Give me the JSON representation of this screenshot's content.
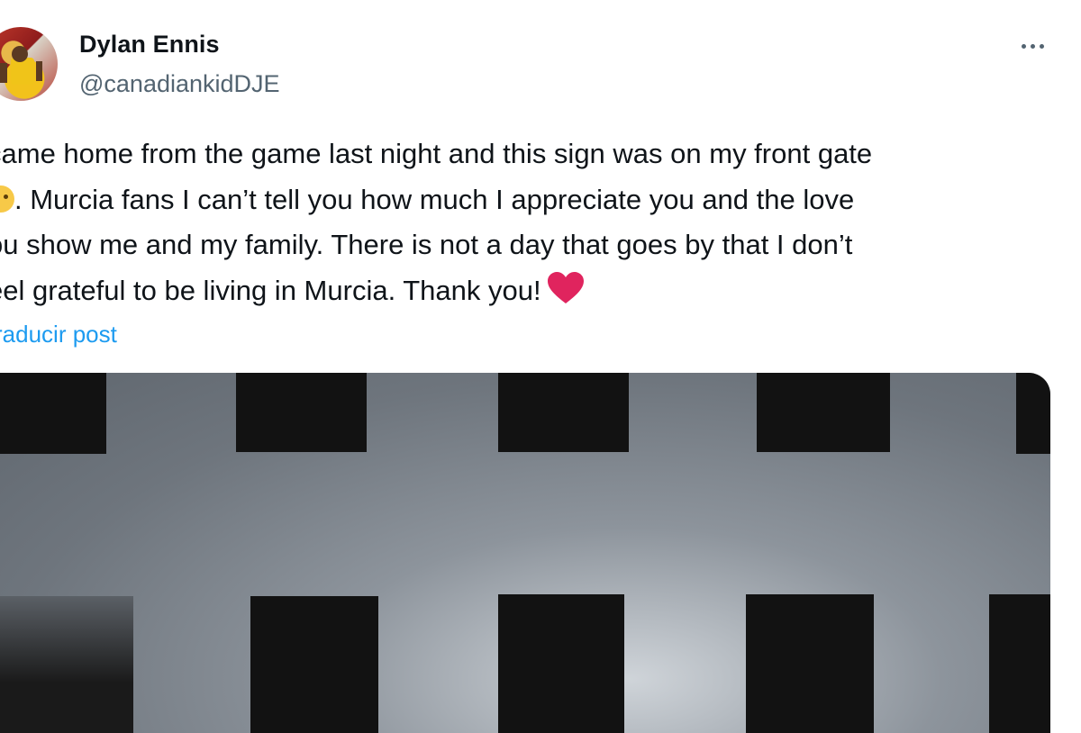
{
  "tweet": {
    "author_name": "Dylan Ennis",
    "author_handle": "@canadiankidDJE",
    "text_line1": "came home from the game last night and this sign was on my front gate",
    "text_line2_after_emoji": ". Murcia fans I can’t tell you how much I appreciate you and the love",
    "text_line3": "ou show me and my family. There is not a day that goes by that I don’t",
    "text_line4": "eel grateful to be living in Murcia. Thank you!",
    "translate_label": "raducir post",
    "icons": {
      "more": "more-horizontal-icon",
      "emoji": "smiling-face-emoji",
      "heart": "red-heart-emoji"
    },
    "colors": {
      "text": "#0f1419",
      "secondary": "#536471",
      "link": "#1d9bf0",
      "heart": "#e0245e"
    }
  }
}
